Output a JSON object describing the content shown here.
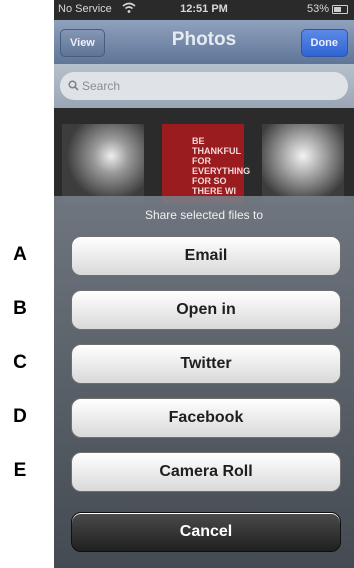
{
  "labels": [
    "A",
    "B",
    "C",
    "D",
    "E"
  ],
  "status_bar": {
    "carrier": "No Service",
    "time": "12:51 PM",
    "battery": "53%"
  },
  "nav_bar": {
    "left_button": "View",
    "title": "Photos",
    "right_button": "Done"
  },
  "search": {
    "placeholder": "Search"
  },
  "thumbnail_text": "BE THANKFUL FOR EVERYTHING FOR SO THERE WI",
  "action_sheet": {
    "title": "Share selected files to",
    "buttons": [
      "Email",
      "Open in",
      "Twitter",
      "Facebook",
      "Camera Roll"
    ],
    "cancel": "Cancel"
  },
  "colors": {
    "nav_bar": "#6f85a6",
    "done_button": "#3f72da",
    "thumb_red": "#9b1c1f",
    "cancel_button": "#2b2b2b"
  }
}
